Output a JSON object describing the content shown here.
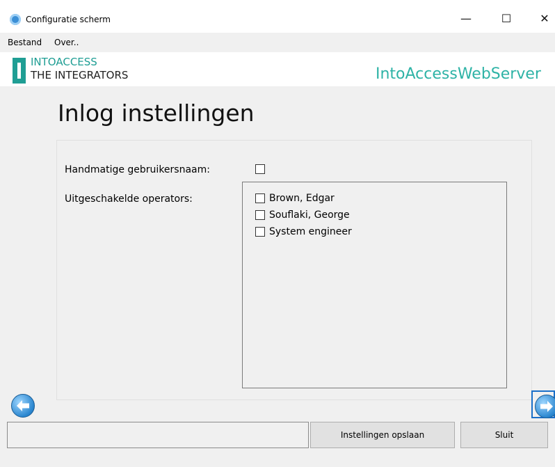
{
  "window": {
    "title": "Configuratie scherm",
    "controls": {
      "minimize": "—",
      "maximize": "☐",
      "close": "✕"
    }
  },
  "menu": {
    "items": [
      "Bestand",
      "Over.."
    ]
  },
  "header": {
    "logo_line1": "INTOACCESS",
    "logo_line2": "THE INTEGRATORS",
    "product": "IntoAccessWebServer",
    "brand_color": "#1f9e94"
  },
  "page": {
    "title": "Inlog instellingen",
    "manual_username_label": "Handmatige gebruikersnaam:",
    "manual_username_checked": false,
    "disabled_operators_label": "Uitgeschakelde operators:",
    "operators": [
      {
        "name": "Brown, Edgar",
        "checked": false
      },
      {
        "name": "Souflaki, George",
        "checked": false
      },
      {
        "name": "System engineer",
        "checked": false
      }
    ]
  },
  "nav": {
    "back_icon": "arrow-left-icon",
    "next_icon": "arrow-right-icon"
  },
  "footer": {
    "save_label": "Instellingen opslaan",
    "close_label": "Sluit"
  }
}
